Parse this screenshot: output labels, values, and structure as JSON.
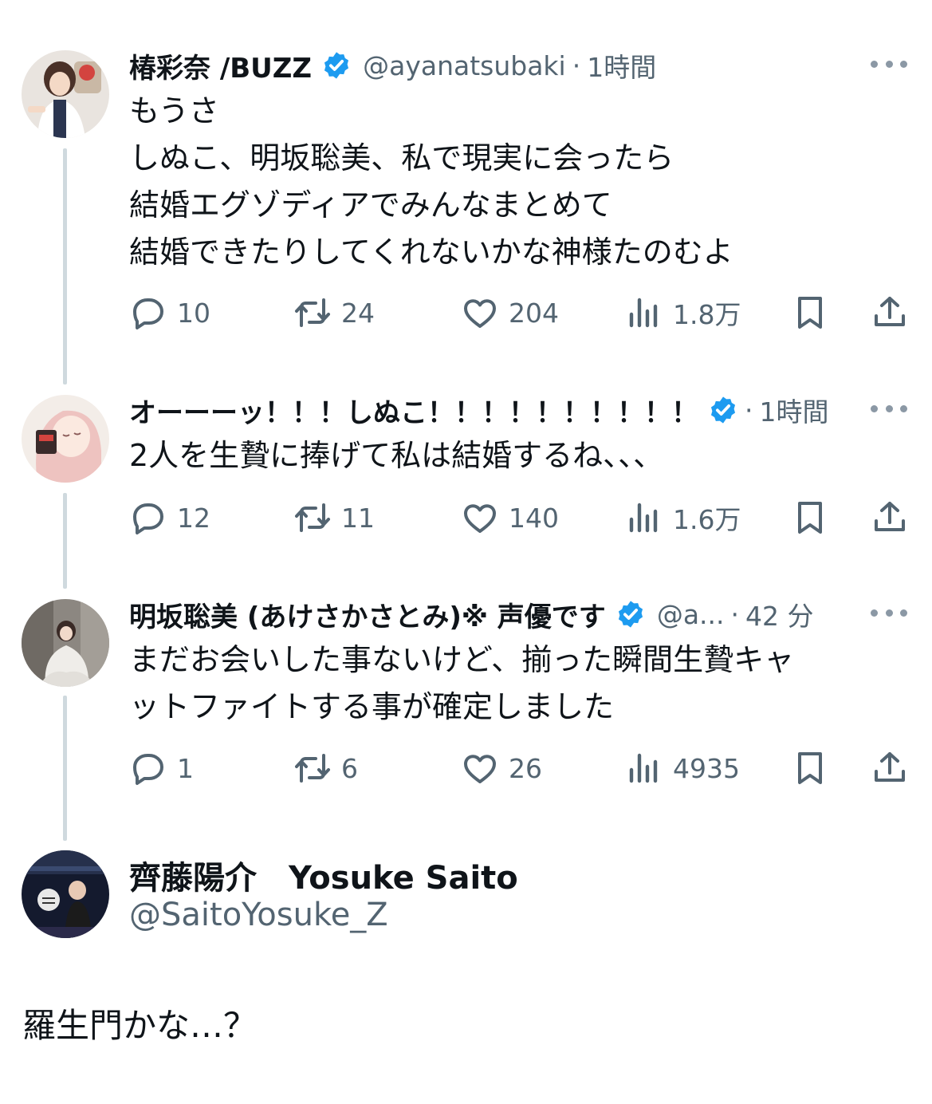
{
  "tweets": [
    {
      "name": "椿彩奈 /BUZZ",
      "handle": "@ayanatsubaki",
      "sep": "·",
      "time": "1時間",
      "lines": [
        "もうさ",
        "しぬこ、明坂聡美、私で現実に会ったら",
        "結婚エグゾディアでみんなまとめて",
        "結婚できたりしてくれないかな神様たのむよ"
      ],
      "replies": "10",
      "retweets": "24",
      "likes": "204",
      "views": "1.8万"
    },
    {
      "name": "オーーーッ！！！しぬこ！！！！！！！！！！",
      "handle": "",
      "sep": "·",
      "time": "1時間",
      "lines": [
        "2人を生贄に捧げて私は結婚するね、、、"
      ],
      "replies": "12",
      "retweets": "11",
      "likes": "140",
      "views": "1.6万"
    },
    {
      "name": "明坂聡美 (あけさかさとみ)※ 声優です",
      "handle": "@a...",
      "sep": "·",
      "time": "42 分",
      "lines": [
        "まだお会いした事ないけど、揃った瞬間生贄キャ",
        "ットファイトする事が確定しました"
      ],
      "replies": "1",
      "retweets": "6",
      "likes": "26",
      "views": "4935"
    }
  ],
  "author": {
    "name": "齊藤陽介　Yosuke Saito",
    "handle": "@SaitoYosuke_Z",
    "text": "羅生門かな…？"
  },
  "icons": {
    "verified": "verified-badge-icon",
    "more": "more-dots-icon",
    "reply": "reply-bubble-icon",
    "retweet": "retweet-arrows-icon",
    "like": "heart-icon",
    "views": "views-bars-icon",
    "bookmark": "bookmark-icon",
    "share": "share-upload-icon"
  },
  "colors": {
    "text": "#0f1419",
    "secondary": "#536471",
    "verified": "#1d9bf0",
    "thread_line": "#cfd9de"
  }
}
